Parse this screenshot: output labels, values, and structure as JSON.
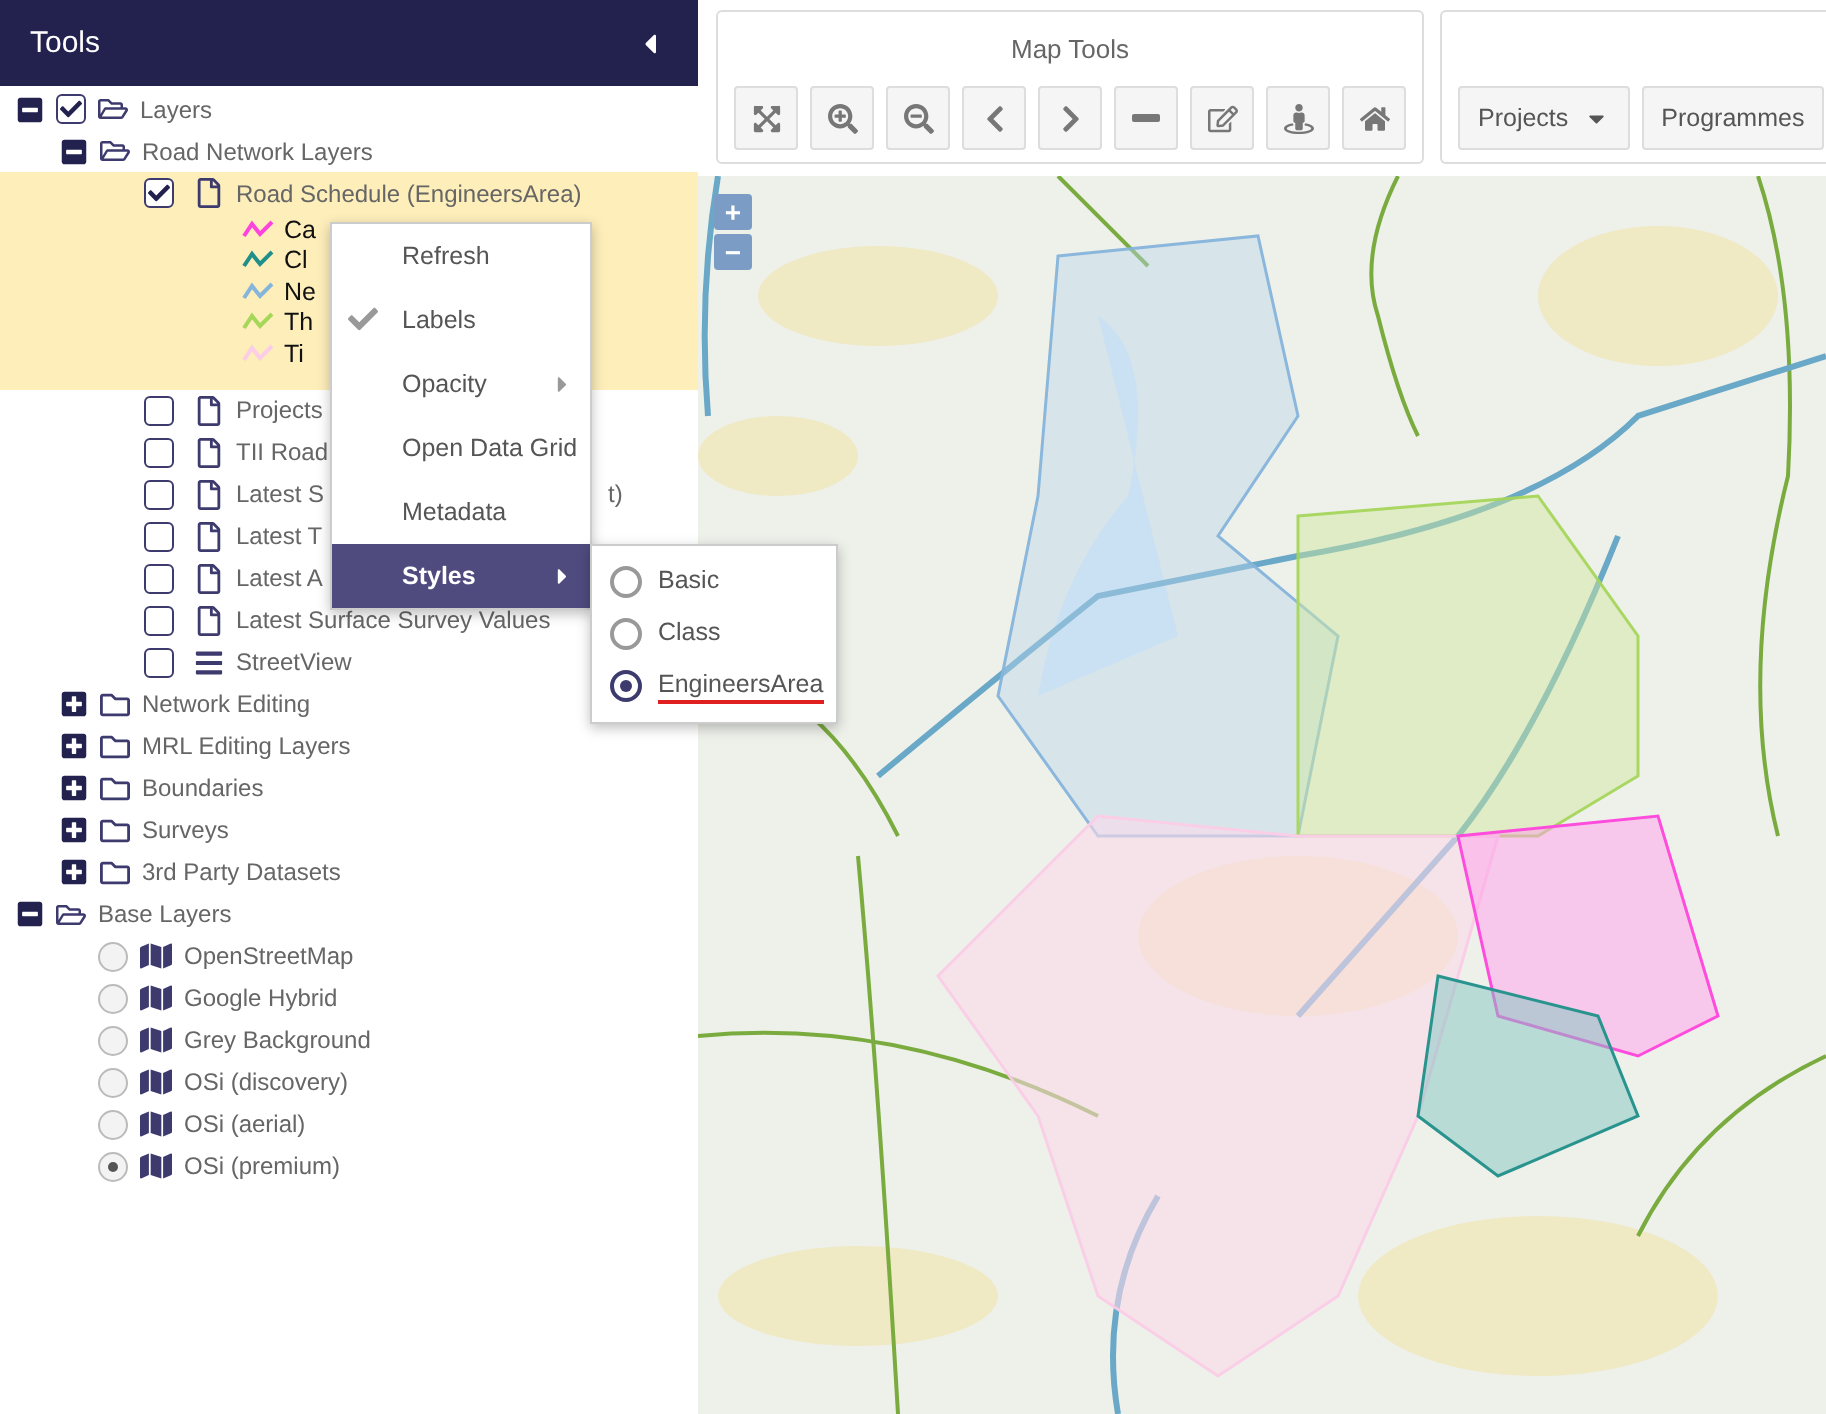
{
  "sidebar": {
    "title": "Tools"
  },
  "tree": [
    {
      "kind": "folder",
      "label": "Layers",
      "expanded": true,
      "checked": true,
      "children": [
        {
          "kind": "folder",
          "label": "Road Network Layers",
          "expanded": true,
          "children": [
            {
              "kind": "layer",
              "label": "Road Schedule (EngineersArea)",
              "checked": true,
              "highlighted": true,
              "legend": [
                {
                  "label": "Ca",
                  "color": "#ff44dd"
                },
                {
                  "label": "Cl",
                  "color": "#1f8f8a"
                },
                {
                  "label": "Ne",
                  "color": "#86b5dc"
                },
                {
                  "label": "Th",
                  "color": "#a6d65a"
                },
                {
                  "label": "Ti",
                  "color": "#fbcde6"
                }
              ]
            },
            {
              "kind": "layer",
              "label": "Projects",
              "checked": false,
              "highlighted": false
            },
            {
              "kind": "layer",
              "label": "TII Road",
              "checked": false,
              "highlighted": false
            },
            {
              "kind": "layer",
              "label": "Latest S",
              "label_tail": "t)",
              "checked": false,
              "highlighted": false
            },
            {
              "kind": "layer",
              "label": "Latest T",
              "checked": false,
              "highlighted": false
            },
            {
              "kind": "layer",
              "label": "Latest A",
              "checked": false,
              "highlighted": false
            },
            {
              "kind": "layer",
              "label": "Latest Surface Survey Values",
              "checked": false,
              "highlighted": false
            },
            {
              "kind": "service",
              "label": "StreetView",
              "checked": false,
              "highlighted": false
            }
          ]
        },
        {
          "kind": "folder",
          "label": "Network Editing",
          "expanded": false
        },
        {
          "kind": "folder",
          "label": "MRL Editing Layers",
          "expanded": false
        },
        {
          "kind": "folder",
          "label": "Boundaries",
          "expanded": false
        },
        {
          "kind": "folder",
          "label": "Surveys",
          "expanded": false
        },
        {
          "kind": "folder",
          "label": "3rd Party Datasets",
          "expanded": false
        }
      ]
    },
    {
      "kind": "folder",
      "label": "Base Layers",
      "expanded": true,
      "children": [
        {
          "kind": "basemap",
          "label": "OpenStreetMap",
          "selected": false
        },
        {
          "kind": "basemap",
          "label": "Google Hybrid",
          "selected": false
        },
        {
          "kind": "basemap",
          "label": "Grey Background",
          "selected": false
        },
        {
          "kind": "basemap",
          "label": "OSi (discovery)",
          "selected": false
        },
        {
          "kind": "basemap",
          "label": "OSi (aerial)",
          "selected": false
        },
        {
          "kind": "basemap",
          "label": "OSi (premium)",
          "selected": true
        }
      ]
    }
  ],
  "context_menu": {
    "items": [
      {
        "label": "Refresh",
        "checked": false,
        "submenu": false,
        "selected": false
      },
      {
        "label": "Labels",
        "checked": true,
        "submenu": false,
        "selected": false
      },
      {
        "label": "Opacity",
        "checked": false,
        "submenu": true,
        "selected": false
      },
      {
        "label": "Open Data Grid",
        "checked": false,
        "submenu": false,
        "selected": false
      },
      {
        "label": "Metadata",
        "checked": false,
        "submenu": false,
        "selected": false
      },
      {
        "label": "Styles",
        "checked": false,
        "submenu": true,
        "selected": true
      }
    ],
    "styles_submenu": [
      {
        "label": "Basic",
        "selected": false
      },
      {
        "label": "Class",
        "selected": false
      },
      {
        "label": "EngineersArea",
        "selected": true
      }
    ]
  },
  "map_tools": {
    "title": "Map Tools",
    "buttons": [
      {
        "kind": "extent"
      },
      {
        "kind": "zoom_in"
      },
      {
        "kind": "zoom_out"
      },
      {
        "kind": "back"
      },
      {
        "kind": "forward"
      },
      {
        "kind": "measure"
      },
      {
        "kind": "edit"
      },
      {
        "kind": "streetview"
      },
      {
        "kind": "home"
      }
    ]
  },
  "project_tools": {
    "buttons": [
      {
        "label": "Projects",
        "dropdown": true
      },
      {
        "label": "Programmes",
        "dropdown": false
      }
    ]
  },
  "map": {
    "zoom_buttons": [
      "+",
      "−"
    ]
  }
}
